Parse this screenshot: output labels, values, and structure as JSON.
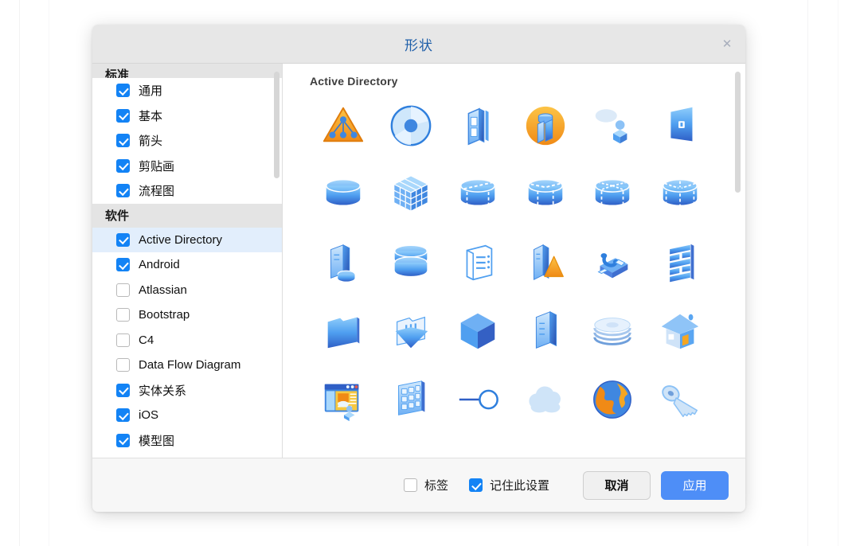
{
  "dialog": {
    "title": "形状",
    "close_icon": "close-icon"
  },
  "sidebar": {
    "groups": [
      {
        "header": "标准",
        "clipped": true,
        "items": [
          {
            "label": "通用",
            "checked": true,
            "selected": false
          },
          {
            "label": "基本",
            "checked": true,
            "selected": false
          },
          {
            "label": "箭头",
            "checked": true,
            "selected": false
          },
          {
            "label": "剪贴画",
            "checked": true,
            "selected": false
          },
          {
            "label": "流程图",
            "checked": true,
            "selected": false
          }
        ]
      },
      {
        "header": "软件",
        "clipped": false,
        "items": [
          {
            "label": "Active Directory",
            "checked": true,
            "selected": true
          },
          {
            "label": "Android",
            "checked": true,
            "selected": false
          },
          {
            "label": "Atlassian",
            "checked": false,
            "selected": false
          },
          {
            "label": "Bootstrap",
            "checked": false,
            "selected": false
          },
          {
            "label": "C4",
            "checked": false,
            "selected": false
          },
          {
            "label": "Data Flow Diagram",
            "checked": false,
            "selected": false
          },
          {
            "label": "实体关系",
            "checked": true,
            "selected": false
          },
          {
            "label": "iOS",
            "checked": true,
            "selected": false
          },
          {
            "label": "模型图",
            "checked": true,
            "selected": false
          }
        ]
      }
    ]
  },
  "shapes_panel": {
    "section_title": "Active Directory",
    "rows": [
      [
        "ad-domain-icon",
        "disc-icon",
        "device-icon",
        "ad-site-icon",
        "user-comment-icon",
        "window-panel-icon"
      ],
      [
        "cylinder-icon",
        "cube-grid-icon",
        "cylinder-split-icon",
        "cylinder-arrow-icon",
        "cylinder-star-icon",
        "cylinder-dashed-icon"
      ],
      [
        "server-disk-icon",
        "database-icon",
        "document-list-icon",
        "server-alert-icon",
        "fax-icon",
        "firewall-icon"
      ],
      [
        "folder-icon",
        "folder-open-icon",
        "cube-icon",
        "server-icon",
        "disk-stack-icon",
        "house-icon"
      ],
      [
        "browser-user-icon",
        "keypad-icon",
        "node-link-icon",
        "cloud-icon",
        "globe-icon",
        "key-icon"
      ],
      [
        "partial-a-icon",
        "partial-b-icon",
        "partial-c-icon",
        "partial-d-icon",
        "partial-e-icon",
        "partial-f-icon"
      ]
    ]
  },
  "footer": {
    "label_checkbox": {
      "label": "标签",
      "checked": false
    },
    "remember_checkbox": {
      "label": "记住此设置",
      "checked": true
    },
    "cancel_button": "取消",
    "apply_button": "应用"
  },
  "colors": {
    "accent_blue": "#1383f5",
    "apply_button": "#4e8ef7",
    "title_blue": "#1f5fa9",
    "selection": "#e2eefc",
    "group_header_bg": "#e4e4e4"
  }
}
